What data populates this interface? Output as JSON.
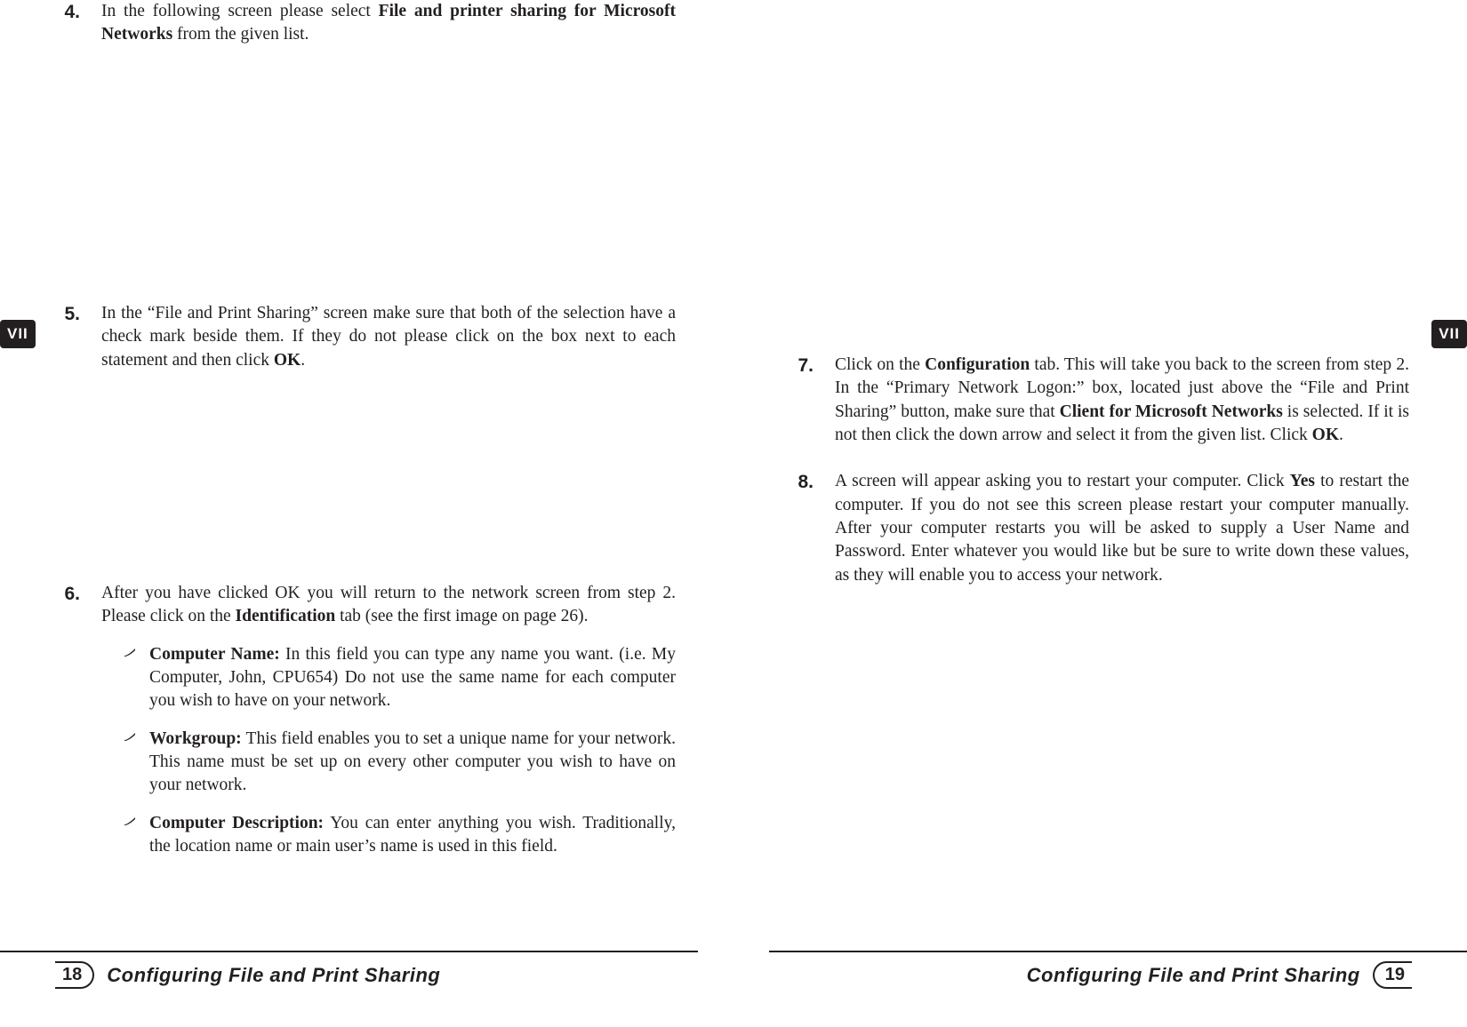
{
  "chapter_tab": "VII",
  "footer_title": "Configuring File and Print Sharing",
  "left_page_number": "18",
  "right_page_number": "19",
  "left": {
    "step4": {
      "num": "4.",
      "pre": "In the following screen please select ",
      "bold": "File and printer sharing for Microsoft Networks",
      "post": " from the given list."
    },
    "step5": {
      "num": "5.",
      "pre": "In the “File and Print Sharing” screen make sure that both of the selection have a check mark beside them. If they do not please click on the box next to each statement and then click ",
      "bold": "OK",
      "post": "."
    },
    "step6": {
      "num": "6.",
      "intro_pre": "After you have clicked OK you will return to the network screen from step 2. Please click on the ",
      "intro_bold": "Identification",
      "intro_post": " tab (see the first image on page 26).",
      "bullets": [
        {
          "label": "Computer Name:",
          "text": " In this field you can type any name you want. (i.e. My Computer, John, CPU654) Do not use the same name for each computer you wish to have on your network."
        },
        {
          "label": "Workgroup:",
          "text": " This field enables you to set a unique name for your network. This name must be set up on every other computer you wish to have on your network."
        },
        {
          "label": "Computer Description:",
          "text": " You can enter anything you wish. Traditionally, the location name or main user’s name is used in this field."
        }
      ]
    }
  },
  "right": {
    "step7": {
      "num": "7.",
      "p1": "Click on the ",
      "b1": "Configuration",
      "p2": " tab. This will take you back to the screen from step 2. In the “Primary Network Logon:” box, located just above the “File and Print Sharing” button, make sure that ",
      "b2": "Client for Microsoft Networks",
      "p3": " is selected. If it is not then click the down arrow and select it from the given list. Click ",
      "b3": "OK",
      "p4": "."
    },
    "step8": {
      "num": "8.",
      "p1": "A screen will appear asking you to restart your computer. Click ",
      "b1": "Yes",
      "p2": " to restart the computer. If you do not see this screen please restart your computer manually. After your computer restarts you will be asked to supply a User Name and Password. Enter whatever you would like but be sure to write down these values, as they will enable you to access your network."
    }
  }
}
